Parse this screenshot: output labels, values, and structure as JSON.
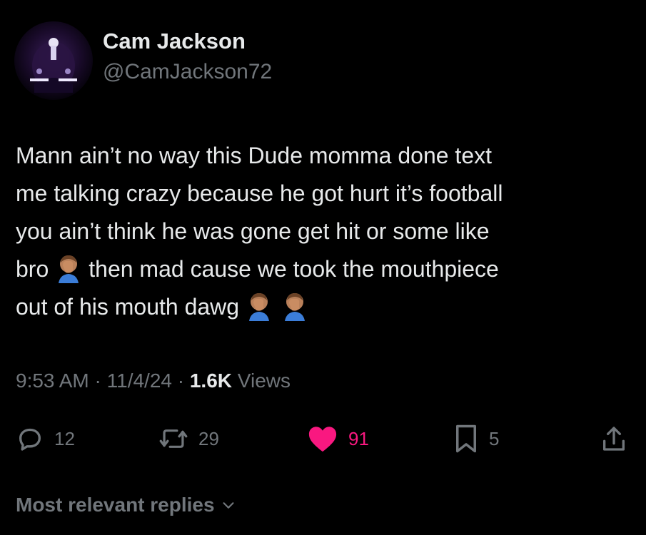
{
  "author": {
    "name": "Cam Jackson",
    "handle": "@CamJackson72"
  },
  "tweet": {
    "line1": "Mann ain’t no way this Dude momma done text",
    "line2": "me talking crazy because he got hurt it’s football",
    "line3": "you ain’t think he was gone get hit or some like",
    "line4_start": "bro",
    "line4_end": "then mad cause we took the mouthpiece",
    "line5": "out of his mouth dawg",
    "emoji": "facepalm-emoji"
  },
  "meta": {
    "time": "9:53 AM",
    "separator": "·",
    "date": "11/4/24",
    "views_count": "1.6K",
    "views_label": "Views"
  },
  "actions": {
    "reply": {
      "icon": "reply-icon",
      "count": "12"
    },
    "retweet": {
      "icon": "retweet-icon",
      "count": "29"
    },
    "like": {
      "icon": "heart-icon",
      "count": "91",
      "active": true
    },
    "bookmark": {
      "icon": "bookmark-icon",
      "count": "5"
    },
    "share": {
      "icon": "share-icon"
    }
  },
  "replies_sort": {
    "label": "Most relevant replies",
    "icon": "chevron-down-icon"
  },
  "colors": {
    "background": "#000000",
    "text_primary": "#e7e9ea",
    "text_secondary": "#71767b",
    "like_pink": "#f91880"
  }
}
